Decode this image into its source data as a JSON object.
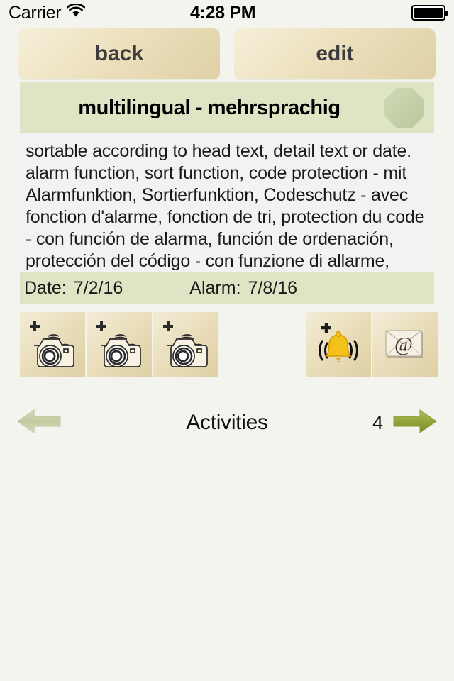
{
  "status_bar": {
    "carrier": "Carrier",
    "wifi_icon": "wifi-icon",
    "time": "4:28 PM",
    "battery_icon": "battery-full-icon"
  },
  "toolbar": {
    "back_label": "back",
    "edit_label": "edit"
  },
  "header": {
    "title": "multilingual - mehrsprachig",
    "badge_icon": "octagon-badge-icon"
  },
  "detail": {
    "body_text": "sortable according to head text, detail text or date. alarm function, sort function, code protection - mit Alarmfunktion, Sortierfunktion, Codeschutz - avec fonction d'alarme, fonction de tri, protection du code - con función de alarma, función de ordenación, protección del código - con funzione di allarme, funzione di ordinamento, di protezione del codice"
  },
  "meta": {
    "date_label": "Date:",
    "date_value": "7/2/16",
    "alarm_label": "Alarm:",
    "alarm_value": "7/8/16"
  },
  "actions": [
    {
      "name": "add-photo-1-button",
      "icon": "camera-plus-icon"
    },
    {
      "name": "add-photo-2-button",
      "icon": "camera-plus-icon"
    },
    {
      "name": "add-photo-3-button",
      "icon": "camera-plus-icon"
    },
    {
      "name": "add-alarm-button",
      "icon": "bell-plus-icon"
    },
    {
      "name": "email-button",
      "icon": "envelope-at-icon"
    }
  ],
  "bottom_nav": {
    "prev_icon": "arrow-left-icon",
    "title": "Activities",
    "count": "4",
    "next_icon": "arrow-right-icon"
  },
  "colors": {
    "page_background": "#f4f4ef",
    "header_green": "#dde5c4",
    "button_tan": "#ece0bd",
    "text_area": "#f2f2f2",
    "arrow_enabled": "#8a9b3a",
    "arrow_disabled": "#c6cba4",
    "bell_yellow": "#f2c21a"
  }
}
